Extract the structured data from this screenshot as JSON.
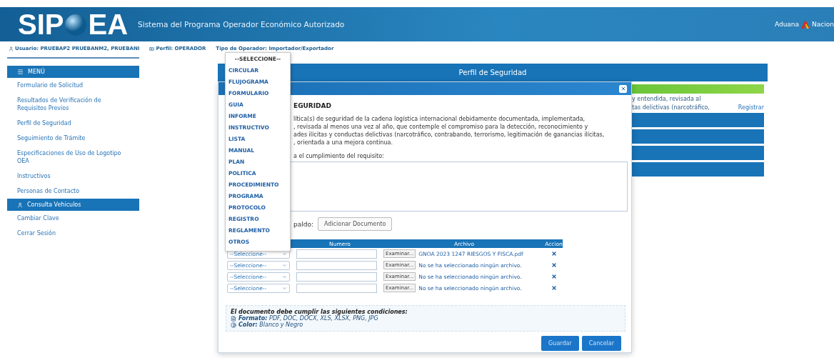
{
  "header": {
    "logo_left": "SIP",
    "logo_right": "EA",
    "subtitle": "Sistema del Programa Operador Económico Autorizado",
    "agency_left": "Aduana",
    "agency_right": "Nacion"
  },
  "user_bar": [
    "Usuario: PRUEBAP2 PRUEBANM2, PRUEBANI",
    "Perfil: OPERADOR",
    "Tipo de Operador: Importador/Exportador"
  ],
  "sidebar": {
    "title": "MENÚ",
    "items": [
      {
        "label": "Formulario de Solicitud",
        "selected": false
      },
      {
        "label": "Resultados de Verificación de Requisitos Previos",
        "selected": false
      },
      {
        "label": "Perfil de Seguridad",
        "selected": false
      },
      {
        "label": "Seguimiento de Trámite",
        "selected": false
      },
      {
        "label": "Especificaciones de Uso de Logotipo OEA",
        "selected": false
      },
      {
        "label": "Instructivos",
        "selected": false
      },
      {
        "label": "Personas de Contacto",
        "selected": false
      },
      {
        "label": "Consulta Vehiculos",
        "selected": true
      },
      {
        "label": "Cambiar Clave",
        "selected": false
      },
      {
        "label": "Cerrar Sesión",
        "selected": false
      }
    ]
  },
  "panel": {
    "title": "Perfil de Seguridad",
    "text_lines": [
      "y entendida, revisada al",
      "tas delictivas (narcotráfico,"
    ],
    "link": "Registrar"
  },
  "modal": {
    "heading": "EGURIDAD",
    "paragraph_lines": [
      "lítica(s) de seguridad de la cadena logística internacional debidamente documentada, implementada,",
      ", revisada al menos una vez al año, que contemple el compromiso para la detección, reconocimiento y",
      "ades ilícitas y conductas delictivas (narcotráfico, contrabando, terrorismo, legitimación de ganancias ilícitas,",
      ", orientada a una mejora continua."
    ],
    "prompt": "a el cumplimiento del requisito:",
    "attach_label": "paldo:",
    "add_button": "Adicionar Documento",
    "table": {
      "columns": [
        "Numero",
        "Archivo",
        "Accion"
      ],
      "rows": [
        {
          "type": "--Seleccione--",
          "file_button": "Examinar...",
          "file": "GNOA 2023 1247 RIESGOS Y FISCA.pdf"
        },
        {
          "type": "--Seleccione--",
          "file_button": "Examinar...",
          "file": "No se ha seleccionado ningún archivo."
        },
        {
          "type": "--Seleccione--",
          "file_button": "Examinar...",
          "file": "No se ha seleccionado ningún archivo."
        },
        {
          "type": "--Seleccione--",
          "file_button": "Examinar...",
          "file": "No se ha seleccionado ningún archivo."
        }
      ]
    },
    "conditions": {
      "title": "El documento debe cumplir las siguientes condiciones:",
      "items": [
        {
          "kind": "file",
          "text": "**Formato:** PDF, DOC, DOCX, XLS, XLSX, PNG, JPG"
        },
        {
          "kind": "color",
          "text": "**Color:** Blanco y Negro"
        }
      ]
    },
    "buttons": [
      "Guardar",
      "Cancelar"
    ]
  },
  "dropdown": {
    "options": [
      "--SELECCIONE--",
      "CIRCULAR",
      "FLUJOGRAMA",
      "FORMULARIO",
      "GUIA",
      "INFORME",
      "INSTRUCTIVO",
      "LISTA",
      "MANUAL",
      "PLAN",
      "POLITICA",
      "PROCEDIMIENTO",
      "PROGRAMA",
      "PROTOCOLO",
      "REGISTRO",
      "REGLAMENTO",
      "OTROS"
    ]
  }
}
